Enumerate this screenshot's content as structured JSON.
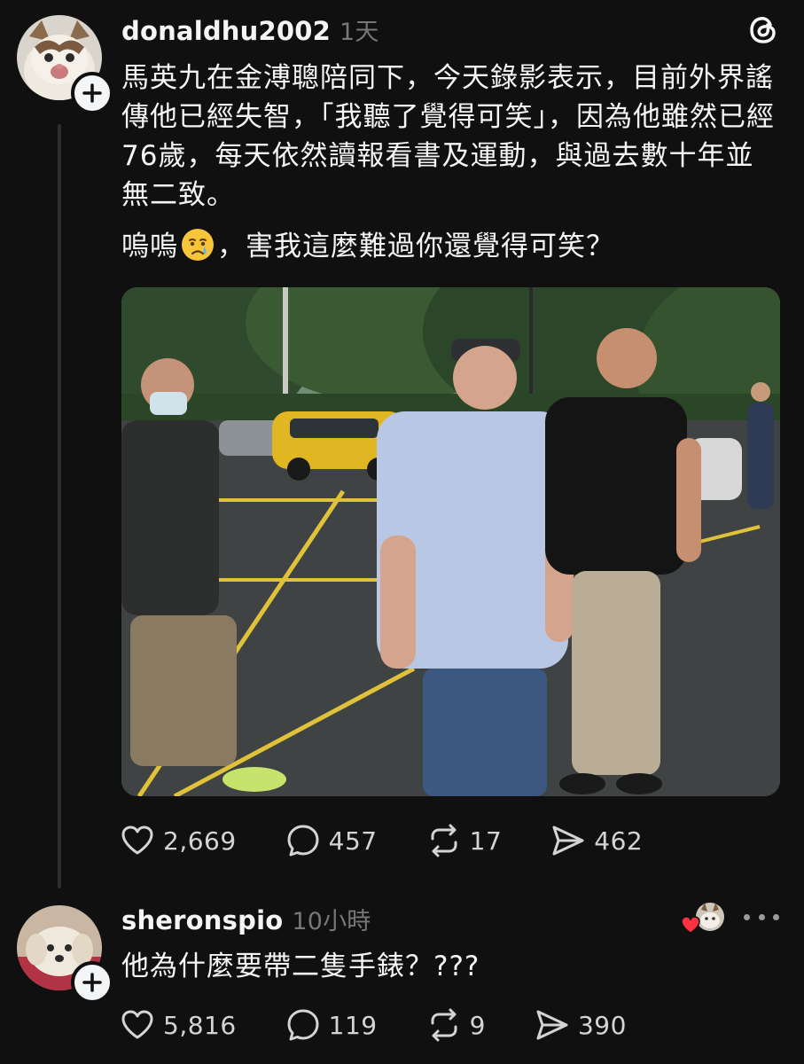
{
  "post": {
    "username": "donaldhu2002",
    "timestamp": "1天",
    "paragraph1": "馬英九在金溥聰陪同下，今天錄影表示，目前外界謠傳他已經失智，「我聽了覺得可笑」，因為他雖然已經76歲，每天依然讀報看書及運動，與過去數十年並無二致。",
    "paragraph2_before": "嗚嗚",
    "paragraph2_emoji": "crying-face-icon",
    "paragraph2_after": "，害我這麼難過你還覺得可笑？",
    "stats": {
      "likes": "2,669",
      "replies": "457",
      "reposts": "17",
      "shares": "462"
    }
  },
  "reply": {
    "username": "sheronspio",
    "timestamp": "10小時",
    "text": "他為什麼要帶二隻手錶？???",
    "stats": {
      "likes": "5,816",
      "replies": "119",
      "reposts": "9",
      "shares": "390"
    }
  },
  "colors": {
    "background": "#101010",
    "text": "#f3f5f7",
    "muted": "#777777",
    "heart_red": "#ff3040"
  },
  "icons": {
    "logo": "threads-logo-icon",
    "like": "heart-icon",
    "reply": "comment-bubble-icon",
    "repost": "repost-arrows-icon",
    "share": "send-icon",
    "more": "more-dots-icon"
  }
}
